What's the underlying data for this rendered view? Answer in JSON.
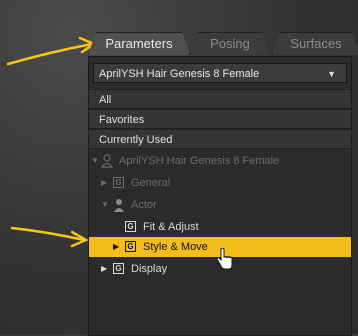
{
  "tabs": [
    {
      "label": "Parameters",
      "active": true
    },
    {
      "label": "Posing",
      "active": false
    },
    {
      "label": "Surfaces",
      "active": false
    }
  ],
  "dropdown": {
    "value": "AprilYSH Hair Genesis 8 Female",
    "caret": "▼"
  },
  "filters": [
    "All",
    "Favorites",
    "Currently Used"
  ],
  "tree": {
    "root": {
      "label": "AprilYSH Hair Genesis 8 Female",
      "expander": "▼"
    },
    "general": {
      "label": "General",
      "expander": "▶",
      "icon": "G"
    },
    "actor": {
      "label": "Actor",
      "expander": "▼"
    },
    "fit_adjust": {
      "label": "Fit & Adjust",
      "icon": "G"
    },
    "style_move": {
      "label": "Style & Move",
      "expander": "▶",
      "icon": "G"
    },
    "display": {
      "label": "Display",
      "expander": "▶",
      "icon": "G"
    }
  },
  "colors": {
    "selection": "#f2bd1d",
    "arrow": "#f5c518"
  }
}
